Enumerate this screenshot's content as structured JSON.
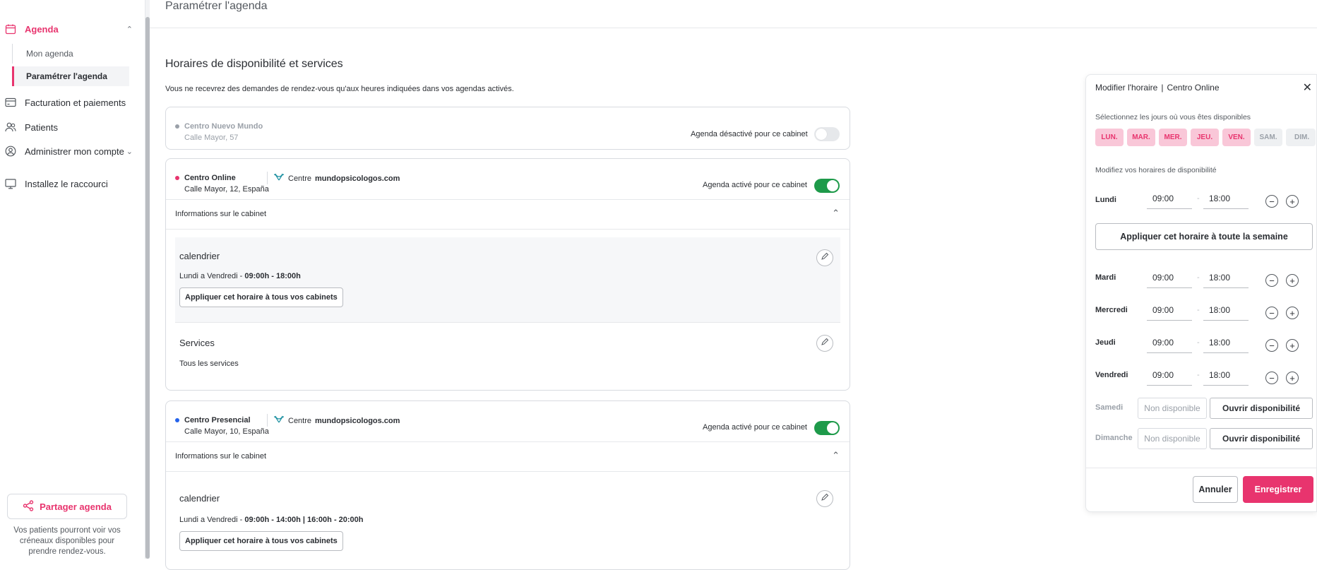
{
  "sidebar": {
    "agenda": "Agenda",
    "mon_agenda": "Mon agenda",
    "parametrer": "Paramétrer l'agenda",
    "facturation": "Facturation et paiements",
    "patients": "Patients",
    "administrer": "Administrer mon compte",
    "raccourci": "Installez le raccourci",
    "share_label": "Partager agenda",
    "share_note": "Vos patients pourront voir vos créneaux disponibles pour prendre rendez-vous."
  },
  "header": {
    "title": "Paramétrer l'agenda"
  },
  "main": {
    "section_title": "Horaires de disponibilité et services",
    "section_sub": "Vous ne recevrez des demandes de rendez-vous qu'aux heures indiquées dans vos agendas activés.",
    "cabinets": [
      {
        "name": "Centro Nuevo Mundo",
        "address": "Calle Mayor, 57",
        "toggle_label": "Agenda désactivé pour ce cabinet"
      },
      {
        "name": "Centro Online",
        "address": "Calle Mayor, 12, España",
        "brand_prefix": "Centre",
        "brand_name": "mundopsicologos.com",
        "toggle_label": "Agenda activé pour ce cabinet",
        "info_label": "Informations sur le cabinet",
        "calendar_title": "calendrier",
        "days": "Lundi a Vendredi -",
        "hours": "09:00h - 18:00h",
        "apply_all": "Appliquer cet horaire à tous vos cabinets",
        "services_title": "Services",
        "services_value": "Tous les services"
      },
      {
        "name": "Centro Presencial",
        "address": "Calle Mayor, 10, España",
        "brand_prefix": "Centre",
        "brand_name": "mundopsicologos.com",
        "toggle_label": "Agenda activé pour ce cabinet",
        "info_label": "Informations sur le cabinet",
        "calendar_title": "calendrier",
        "days": "Lundi a Vendredi -",
        "hours": "09:00h - 14:00h |  16:00h - 20:00h",
        "apply_all": "Appliquer cet horaire à tous vos cabinets"
      }
    ]
  },
  "modal": {
    "title": "Modifier l'horaire",
    "sep": "|",
    "cabinet": "Centro Online",
    "select_days_label": "Sélectionnez les jours où vous êtes disponibles",
    "day_pills": [
      "LUN.",
      "MAR.",
      "MER.",
      "JEU.",
      "VEN.",
      "SAM.",
      "DIM."
    ],
    "modify_label": "Modifiez vos horaires de disponibilité",
    "apply_week": "Appliquer cet horaire à toute la semaine",
    "days": [
      {
        "name": "Lundi",
        "start": "09:00",
        "end": "18:00"
      },
      {
        "name": "Mardi",
        "start": "09:00",
        "end": "18:00"
      },
      {
        "name": "Mercredi",
        "start": "09:00",
        "end": "18:00"
      },
      {
        "name": "Jeudi",
        "start": "09:00",
        "end": "18:00"
      },
      {
        "name": "Vendredi",
        "start": "09:00",
        "end": "18:00"
      }
    ],
    "closed_days": [
      {
        "name": "Samedi",
        "status": "Non disponible",
        "open_label": "Ouvrir disponibilité"
      },
      {
        "name": "Dimanche",
        "status": "Non disponible",
        "open_label": "Ouvrir disponibilité"
      }
    ],
    "dash": "-",
    "cancel": "Annuler",
    "save": "Enregistrer"
  },
  "colors": {
    "accent": "#e8346e",
    "toggle_on": "#1e9a4a",
    "dot_gray": "#9aa0a8",
    "dot_pink": "#e8346e",
    "dot_blue": "#2563eb"
  }
}
